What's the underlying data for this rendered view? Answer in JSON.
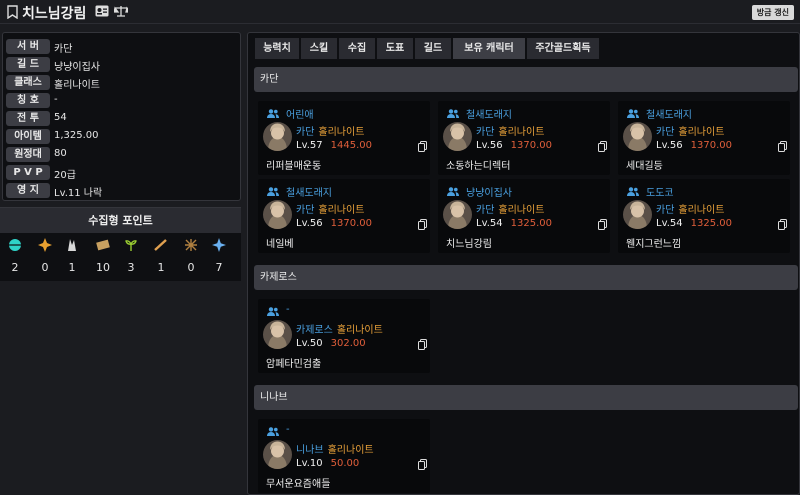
{
  "header": {
    "title": "치느님강림",
    "refresh_label": "방금 갱신"
  },
  "info": [
    {
      "label": "서 버",
      "value": "카단"
    },
    {
      "label": "길 드",
      "value": "냥냥이집사"
    },
    {
      "label": "클래스",
      "value": "홀리나이트"
    },
    {
      "label": "칭 호",
      "value": "-"
    },
    {
      "label": "전 투",
      "value": "54"
    },
    {
      "label": "아이템",
      "value": "1,325.00"
    },
    {
      "label": "원정대",
      "value": "80"
    },
    {
      "label": "P V P",
      "value": "20급"
    },
    {
      "label": "영 지",
      "value": "Lv.11 나락"
    }
  ],
  "collection": {
    "title": "수집형 포인트",
    "items": [
      {
        "icon": "island-heart-icon",
        "count": "2",
        "color": "#2fd3c8"
      },
      {
        "icon": "giant-heart-icon",
        "count": "0",
        "color": "#e8a030"
      },
      {
        "icon": "mokoko-seed-icon",
        "count": "1",
        "color": "#d8d8d8"
      },
      {
        "icon": "art-icon",
        "count": "10",
        "color": "#c8a060"
      },
      {
        "icon": "sprout-icon",
        "count": "3",
        "color": "#9acd32"
      },
      {
        "icon": "voyage-icon",
        "count": "1",
        "color": "#e0a050"
      },
      {
        "icon": "world-tree-leaf-icon",
        "count": "0",
        "color": "#b08040"
      },
      {
        "icon": "orpheus-star-icon",
        "count": "7",
        "color": "#6ab0f0"
      }
    ]
  },
  "tabs": [
    "능력치",
    "스킬",
    "수집",
    "도표",
    "길드",
    "보유 캐릭터",
    "주간골드획득"
  ],
  "active_tab": "보유 캐릭터",
  "sections": [
    {
      "server": "카단",
      "characters": [
        {
          "guild": "어린애",
          "server": "카단",
          "class": "홀리나이트",
          "level": "Lv.57",
          "item_level": "1445.00",
          "name": "리퍼블매운동"
        },
        {
          "guild": "철새도래지",
          "server": "카단",
          "class": "홀리나이트",
          "level": "Lv.56",
          "item_level": "1370.00",
          "name": "소동하는디렉터"
        },
        {
          "guild": "철새도래지",
          "server": "카단",
          "class": "홀리나이트",
          "level": "Lv.56",
          "item_level": "1370.00",
          "name": "세대길등"
        },
        {
          "guild": "철새도래지",
          "server": "카단",
          "class": "홀리나이트",
          "level": "Lv.56",
          "item_level": "1370.00",
          "name": "네일베"
        },
        {
          "guild": "냥냥이집사",
          "server": "카단",
          "class": "홀리나이트",
          "level": "Lv.54",
          "item_level": "1325.00",
          "name": "치느님강림"
        },
        {
          "guild": "도도코",
          "server": "카단",
          "class": "홀리나이트",
          "level": "Lv.54",
          "item_level": "1325.00",
          "name": "웬지그런느낌"
        }
      ]
    },
    {
      "server": "카제로스",
      "characters": [
        {
          "guild": "-",
          "server": "카제로스",
          "class": "홀리나이트",
          "level": "Lv.50",
          "item_level": "302.00",
          "name": "암페타민검출"
        }
      ]
    },
    {
      "server": "니나브",
      "characters": [
        {
          "guild": "-",
          "server": "니나브",
          "class": "홀리나이트",
          "level": "Lv.10",
          "item_level": "50.00",
          "name": "무서운요즘애들"
        }
      ]
    }
  ]
}
